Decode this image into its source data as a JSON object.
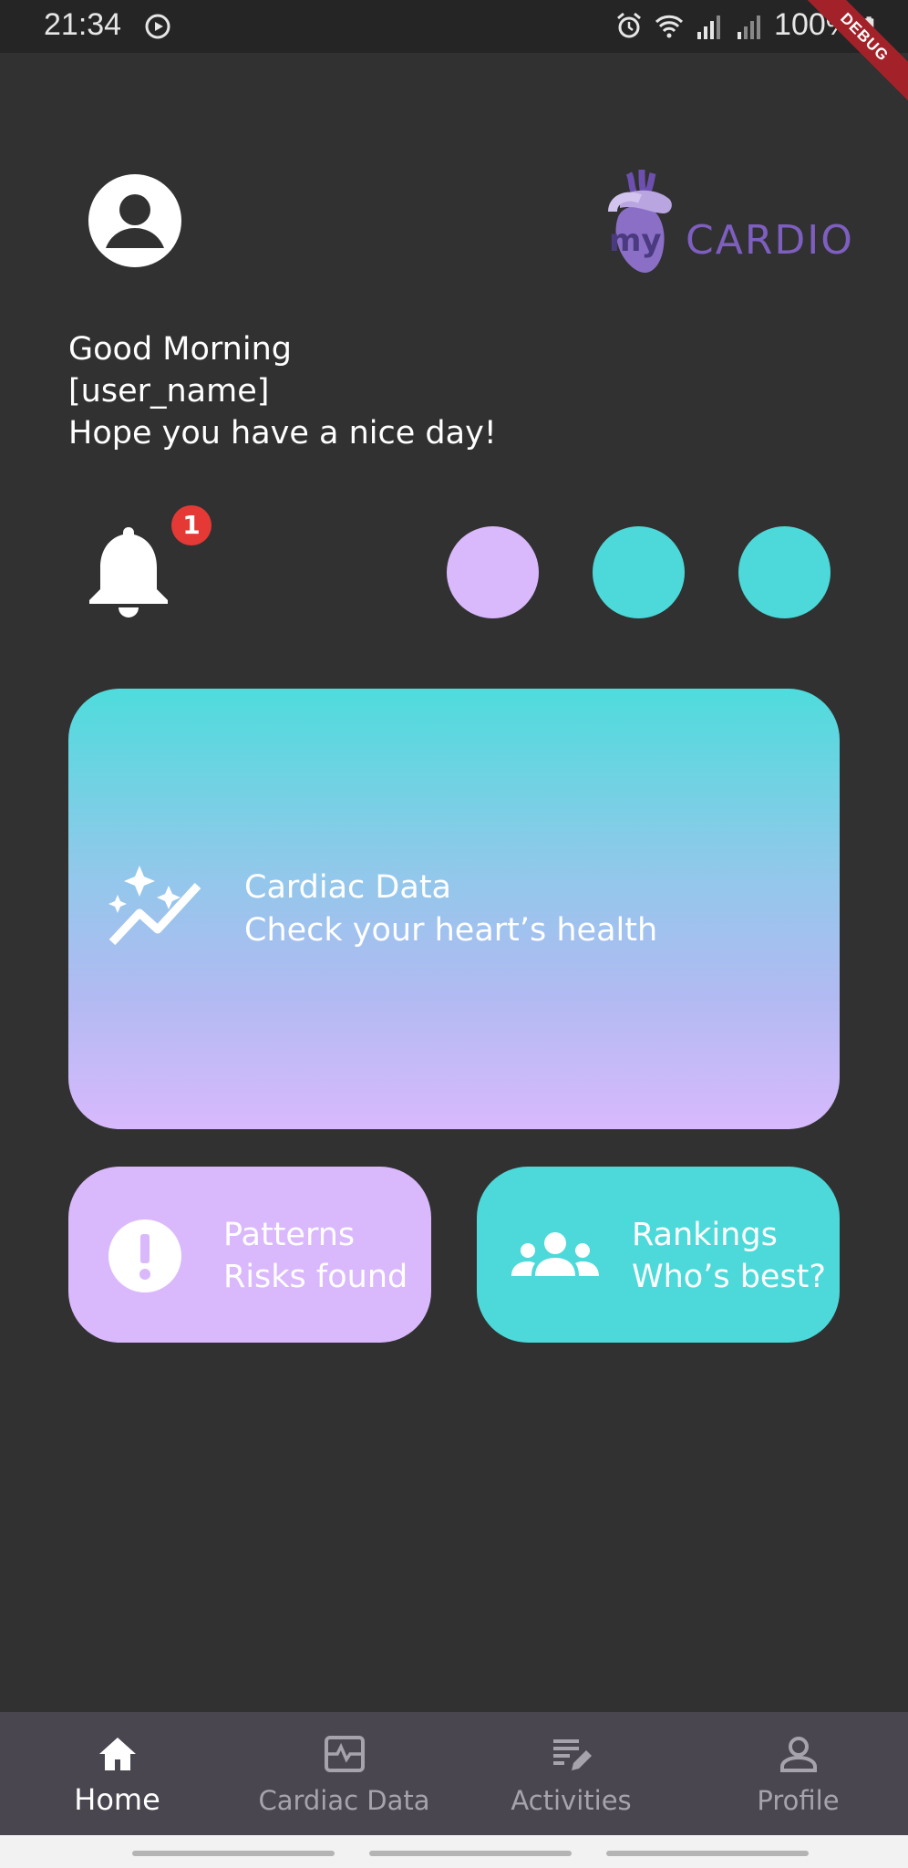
{
  "status_bar": {
    "time": "21:34",
    "battery": "100%",
    "debug_label": "DEBUG"
  },
  "header": {
    "logo_prefix": "my",
    "logo_text": "CARDIO"
  },
  "greeting": {
    "line1": "Good Morning",
    "line2": "[user_name]",
    "line3": "Hope you have a nice day!"
  },
  "notifications": {
    "badge_count": "1"
  },
  "indicator_colors": [
    "#dab8fc",
    "#4dd9d9",
    "#4dd9d9"
  ],
  "cards": {
    "cardiac": {
      "title": "Cardiac Data",
      "subtitle": "Check your heart’s health",
      "icon": "auto-graph-icon"
    },
    "patterns": {
      "title": "Patterns",
      "subtitle": "Risks found",
      "icon": "alert-circle-icon",
      "color": "#dab8fc"
    },
    "rankings": {
      "title": "Rankings",
      "subtitle": "Who’s best?",
      "icon": "groups-icon",
      "color": "#4dd9d9"
    }
  },
  "bottom_nav": {
    "items": [
      {
        "label": "Home",
        "icon": "home-icon",
        "active": true
      },
      {
        "label": "Cardiac Data",
        "icon": "monitor-heart-icon",
        "active": false
      },
      {
        "label": "Activities",
        "icon": "edit-note-icon",
        "active": false
      },
      {
        "label": "Profile",
        "icon": "person-icon",
        "active": false
      }
    ]
  },
  "colors": {
    "background": "#313131",
    "accent_teal": "#4dd9d9",
    "accent_purple": "#dab8fc",
    "logo_purple": "#7e5fc0"
  }
}
